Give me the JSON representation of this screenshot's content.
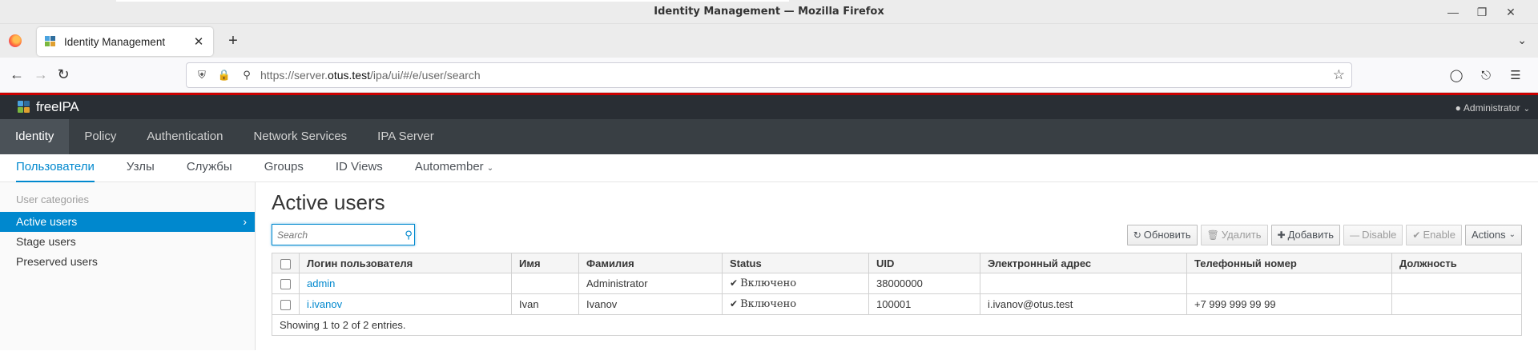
{
  "window": {
    "title": "Identity Management — Mozilla Firefox"
  },
  "browser": {
    "tab_title": "Identity Management",
    "url_prefix": "https://server.",
    "url_host": "otus.test",
    "url_path": "/ipa/ui/#/e/user/search"
  },
  "app": {
    "brand": "freeIPA",
    "user_menu": "Administrator",
    "primary_nav": [
      "Identity",
      "Policy",
      "Authentication",
      "Network Services",
      "IPA Server"
    ],
    "secondary_nav": [
      "Пользователи",
      "Узлы",
      "Службы",
      "Groups",
      "ID Views",
      "Automember"
    ]
  },
  "sidebar": {
    "title": "User categories",
    "items": [
      "Active users",
      "Stage users",
      "Preserved users"
    ]
  },
  "main": {
    "page_title": "Active users",
    "search_placeholder": "Search",
    "buttons": {
      "refresh": "Обновить",
      "delete": "Удалить",
      "add": "Добавить",
      "disable": "Disable",
      "enable": "Enable",
      "actions": "Actions"
    },
    "columns": [
      "Логин пользователя",
      "Имя",
      "Фамилия",
      "Status",
      "UID",
      "Электронный адрес",
      "Телефонный номер",
      "Должность"
    ],
    "rows": [
      [
        "admin",
        "",
        "Administrator",
        "Включено",
        "38000000",
        "",
        "",
        ""
      ],
      [
        "i.ivanov",
        "Ivan",
        "Ivanov",
        "Включено",
        "100001",
        "i.ivanov@otus.test",
        "+7 999 999 99 99",
        ""
      ]
    ],
    "footer": "Showing 1 to 2 of 2 entries."
  },
  "colors": {
    "accent": "#0088ce",
    "header_bg": "#292e34",
    "primary_nav_bg": "#393f44",
    "brand_red": "#cc0000"
  }
}
